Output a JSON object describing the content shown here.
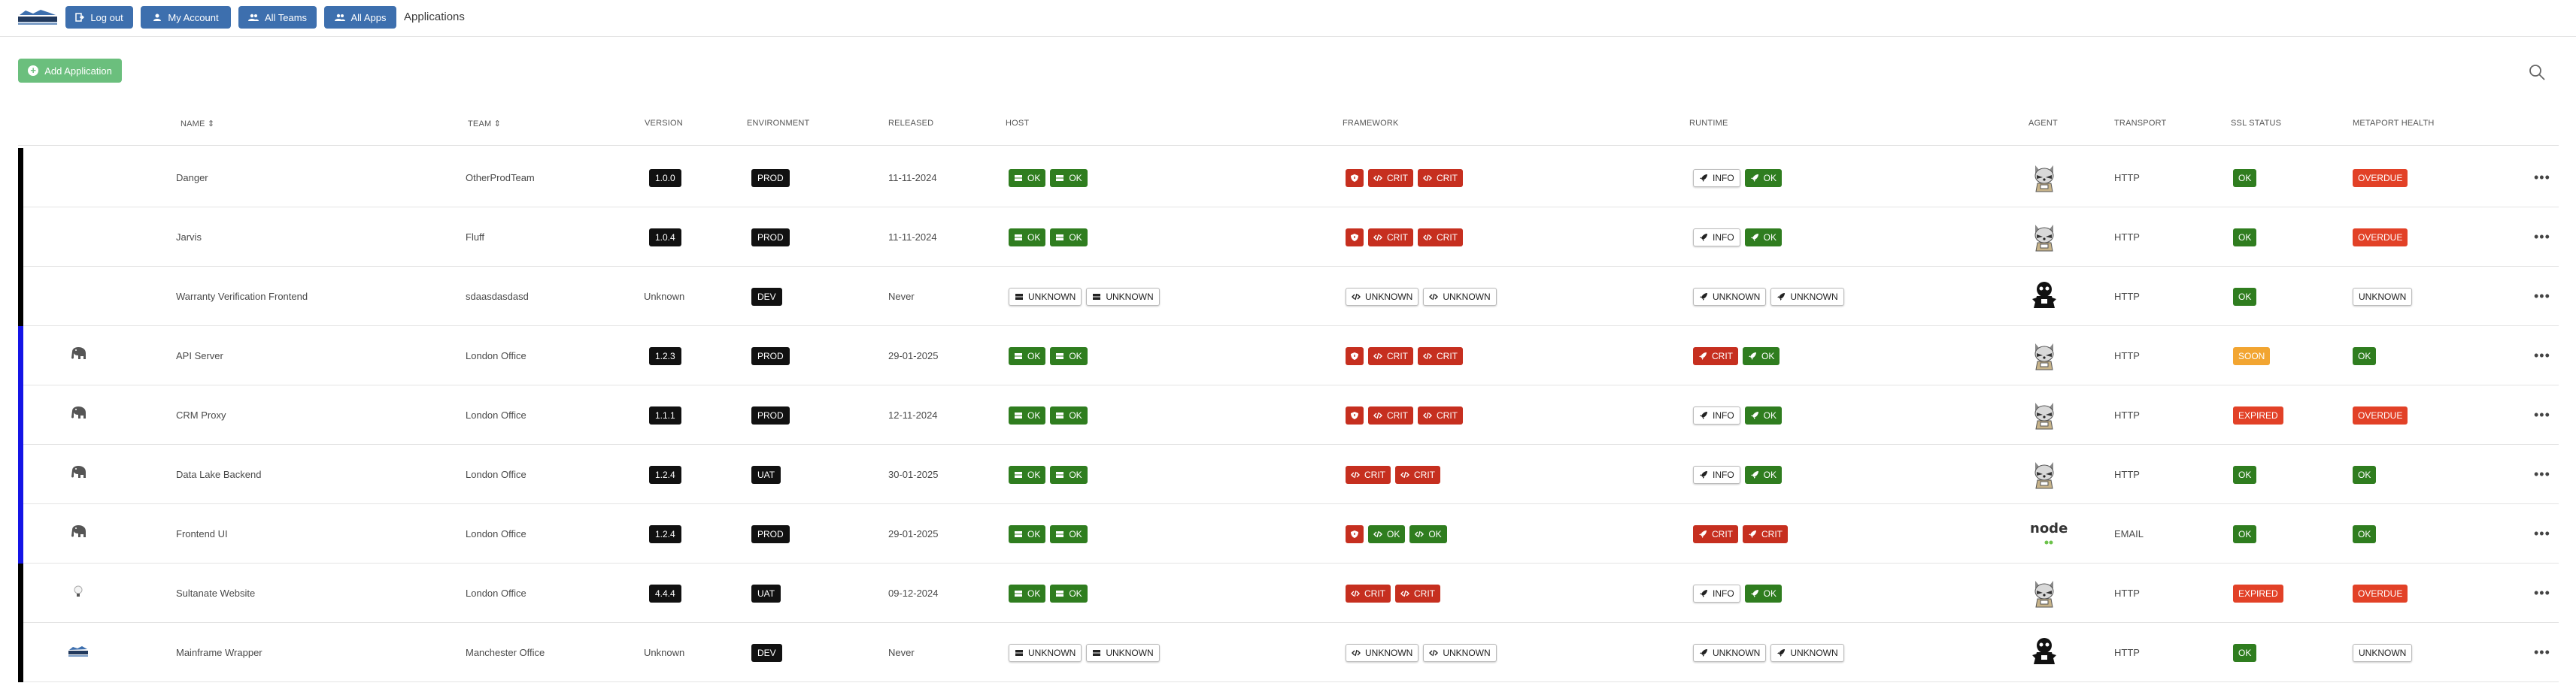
{
  "nav": {
    "logout": "Log out",
    "my_account": "My Account",
    "all_teams": "All Teams",
    "all_apps": "All Apps",
    "title": "Applications"
  },
  "actions": {
    "add_application": "Add Application"
  },
  "headers": {
    "name": "NAME",
    "team": "TEAM",
    "version": "VERSION",
    "environment": "ENVIRONMENT",
    "released": "RELEASED",
    "host": "HOST",
    "framework": "FRAMEWORK",
    "runtime": "RUNTIME",
    "agent": "AGENT",
    "transport": "TRANSPORT",
    "ssl_status": "SSL STATUS",
    "health": "METAPORT HEALTH"
  },
  "colors": {
    "nav_button": "#3d6fae",
    "add_button": "#6bbf7d",
    "ok": "#2f7d1f",
    "crit": "#c62f1f",
    "soon": "#f2a531",
    "expired": "#e24127"
  },
  "rows": [
    {
      "bar": "#000000",
      "icon": "",
      "name": "Danger",
      "team": "OtherProdTeam",
      "version": "1.0.0",
      "version_badge": true,
      "environment": "PROD",
      "released": "11-11-2024",
      "host": [
        {
          "s": "ok",
          "t": "OK"
        },
        {
          "s": "ok",
          "t": "OK"
        }
      ],
      "framework": [
        {
          "s": "crit",
          "icon": "shield"
        },
        {
          "s": "crit",
          "t": "CRIT"
        },
        {
          "s": "crit",
          "t": "CRIT"
        }
      ],
      "runtime": [
        {
          "s": "info",
          "t": "INFO"
        },
        {
          "s": "ok",
          "t": "OK"
        }
      ],
      "agent": "raccoon",
      "transport": "HTTP",
      "ssl": {
        "s": "ok",
        "t": "OK"
      },
      "health": {
        "s": "overdue",
        "t": "OVERDUE"
      }
    },
    {
      "bar": "#000000",
      "icon": "",
      "name": "Jarvis",
      "team": "Fluff",
      "version": "1.0.4",
      "version_badge": true,
      "environment": "PROD",
      "released": "11-11-2024",
      "host": [
        {
          "s": "ok",
          "t": "OK"
        },
        {
          "s": "ok",
          "t": "OK"
        }
      ],
      "framework": [
        {
          "s": "crit",
          "icon": "shield"
        },
        {
          "s": "crit",
          "t": "CRIT"
        },
        {
          "s": "crit",
          "t": "CRIT"
        }
      ],
      "runtime": [
        {
          "s": "info",
          "t": "INFO"
        },
        {
          "s": "ok",
          "t": "OK"
        }
      ],
      "agent": "raccoon",
      "transport": "HTTP",
      "ssl": {
        "s": "ok",
        "t": "OK"
      },
      "health": {
        "s": "overdue",
        "t": "OVERDUE"
      }
    },
    {
      "bar": "#000000",
      "icon": "",
      "name": "Warranty Verification Frontend",
      "team": "sdaasdasdasd",
      "version": "Unknown",
      "version_badge": false,
      "environment": "DEV",
      "released": "Never",
      "host": [
        {
          "s": "unknown",
          "t": "UNKNOWN"
        },
        {
          "s": "unknown",
          "t": "UNKNOWN"
        }
      ],
      "framework": [
        {
          "s": "unknown",
          "t": "UNKNOWN"
        },
        {
          "s": "unknown",
          "t": "UNKNOWN"
        }
      ],
      "runtime": [
        {
          "s": "unknown",
          "t": "UNKNOWN"
        },
        {
          "s": "unknown",
          "t": "UNKNOWN"
        }
      ],
      "agent": "unknown-agent",
      "transport": "HTTP",
      "ssl": {
        "s": "ok",
        "t": "OK"
      },
      "health": {
        "s": "unknown",
        "t": "UNKNOWN"
      }
    },
    {
      "bar": "#1414e6",
      "icon": "elephant",
      "name": "API Server",
      "team": "London Office",
      "version": "1.2.3",
      "version_badge": true,
      "environment": "PROD",
      "released": "29-01-2025",
      "host": [
        {
          "s": "ok",
          "t": "OK"
        },
        {
          "s": "ok",
          "t": "OK"
        }
      ],
      "framework": [
        {
          "s": "crit",
          "icon": "shield"
        },
        {
          "s": "crit",
          "t": "CRIT"
        },
        {
          "s": "crit",
          "t": "CRIT"
        }
      ],
      "runtime": [
        {
          "s": "crit",
          "t": "CRIT"
        },
        {
          "s": "ok",
          "t": "OK"
        }
      ],
      "agent": "raccoon",
      "transport": "HTTP",
      "ssl": {
        "s": "soon",
        "t": "SOON"
      },
      "health": {
        "s": "ok",
        "t": "OK"
      }
    },
    {
      "bar": "#1414e6",
      "icon": "elephant",
      "name": "CRM Proxy",
      "team": "London Office",
      "version": "1.1.1",
      "version_badge": true,
      "environment": "PROD",
      "released": "12-11-2024",
      "host": [
        {
          "s": "ok",
          "t": "OK"
        },
        {
          "s": "ok",
          "t": "OK"
        }
      ],
      "framework": [
        {
          "s": "crit",
          "icon": "shield"
        },
        {
          "s": "crit",
          "t": "CRIT"
        },
        {
          "s": "crit",
          "t": "CRIT"
        }
      ],
      "runtime": [
        {
          "s": "info",
          "t": "INFO"
        },
        {
          "s": "ok",
          "t": "OK"
        }
      ],
      "agent": "raccoon",
      "transport": "HTTP",
      "ssl": {
        "s": "expired",
        "t": "EXPIRED"
      },
      "health": {
        "s": "overdue",
        "t": "OVERDUE"
      }
    },
    {
      "bar": "#1414e6",
      "icon": "elephant",
      "name": "Data Lake Backend",
      "team": "London Office",
      "version": "1.2.4",
      "version_badge": true,
      "environment": "UAT",
      "released": "30-01-2025",
      "host": [
        {
          "s": "ok",
          "t": "OK"
        },
        {
          "s": "ok",
          "t": "OK"
        }
      ],
      "framework": [
        {
          "s": "crit",
          "t": "CRIT"
        },
        {
          "s": "crit",
          "t": "CRIT"
        }
      ],
      "runtime": [
        {
          "s": "info",
          "t": "INFO"
        },
        {
          "s": "ok",
          "t": "OK"
        }
      ],
      "agent": "raccoon",
      "transport": "HTTP",
      "ssl": {
        "s": "ok",
        "t": "OK"
      },
      "health": {
        "s": "ok",
        "t": "OK"
      }
    },
    {
      "bar": "#1414e6",
      "icon": "elephant",
      "name": "Frontend UI",
      "team": "London Office",
      "version": "1.2.4",
      "version_badge": true,
      "environment": "PROD",
      "released": "29-01-2025",
      "host": [
        {
          "s": "ok",
          "t": "OK"
        },
        {
          "s": "ok",
          "t": "OK"
        }
      ],
      "framework": [
        {
          "s": "crit",
          "icon": "shield"
        },
        {
          "s": "ok",
          "t": "OK"
        },
        {
          "s": "ok",
          "t": "OK"
        }
      ],
      "runtime": [
        {
          "s": "crit",
          "t": "CRIT"
        },
        {
          "s": "crit",
          "t": "CRIT"
        }
      ],
      "agent": "node",
      "agent_text": "node",
      "transport": "EMAIL",
      "ssl": {
        "s": "ok",
        "t": "OK"
      },
      "health": {
        "s": "ok",
        "t": "OK"
      }
    },
    {
      "bar": "#000000",
      "icon": "bulb",
      "name": "Sultanate Website",
      "team": "London Office",
      "version": "4.4.4",
      "version_badge": true,
      "environment": "UAT",
      "released": "09-12-2024",
      "host": [
        {
          "s": "ok",
          "t": "OK"
        },
        {
          "s": "ok",
          "t": "OK"
        }
      ],
      "framework": [
        {
          "s": "crit",
          "t": "CRIT"
        },
        {
          "s": "crit",
          "t": "CRIT"
        }
      ],
      "runtime": [
        {
          "s": "info",
          "t": "INFO"
        },
        {
          "s": "ok",
          "t": "OK"
        }
      ],
      "agent": "raccoon",
      "transport": "HTTP",
      "ssl": {
        "s": "expired",
        "t": "EXPIRED"
      },
      "health": {
        "s": "overdue",
        "t": "OVERDUE"
      }
    },
    {
      "bar": "#000000",
      "icon": "metaport",
      "name": "Mainframe Wrapper",
      "team": "Manchester Office",
      "version": "Unknown",
      "version_badge": false,
      "environment": "DEV",
      "released": "Never",
      "host": [
        {
          "s": "unknown",
          "t": "UNKNOWN"
        },
        {
          "s": "unknown",
          "t": "UNKNOWN"
        }
      ],
      "framework": [
        {
          "s": "unknown",
          "t": "UNKNOWN"
        },
        {
          "s": "unknown",
          "t": "UNKNOWN"
        }
      ],
      "runtime": [
        {
          "s": "unknown",
          "t": "UNKNOWN"
        },
        {
          "s": "unknown",
          "t": "UNKNOWN"
        }
      ],
      "agent": "unknown-agent",
      "transport": "HTTP",
      "ssl": {
        "s": "ok",
        "t": "OK"
      },
      "health": {
        "s": "unknown",
        "t": "UNKNOWN"
      }
    }
  ]
}
